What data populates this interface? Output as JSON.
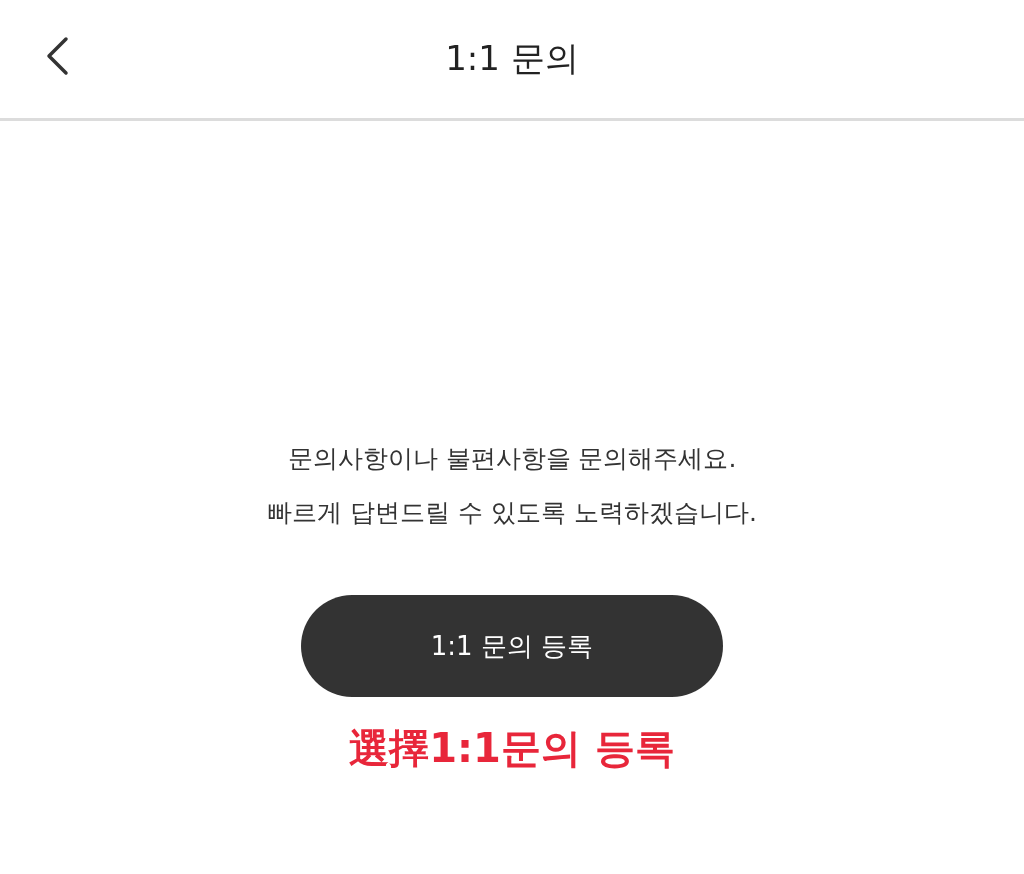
{
  "header": {
    "title": "1:1 문의"
  },
  "message": [
    "문의사항이나 불편사항을 문의해주세요.",
    "빠르게 답변드릴 수 있도록 노력하겠습니다."
  ],
  "button": {
    "label": "1:1 문의 등록"
  },
  "annotation": {
    "text": "選擇1:1문의 등록",
    "color": "#e8263a"
  }
}
